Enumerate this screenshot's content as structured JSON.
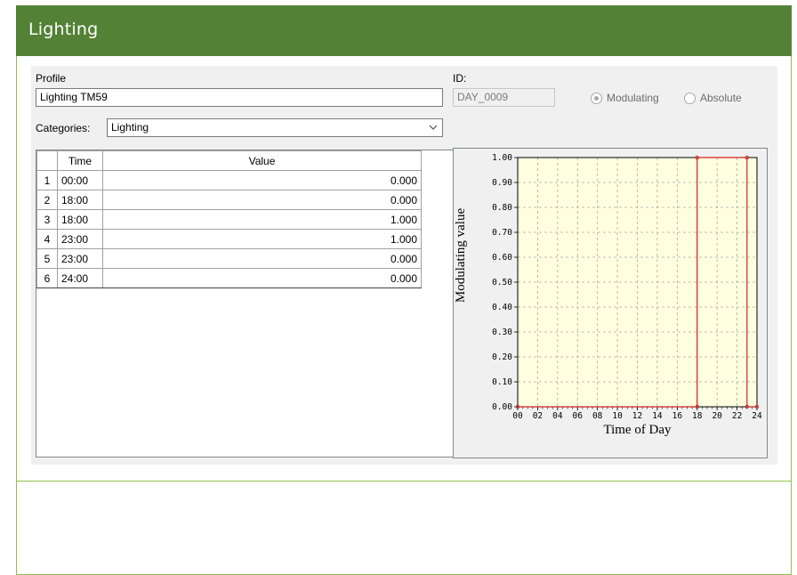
{
  "header": {
    "title": "Lighting"
  },
  "form": {
    "profile_label": "Profile",
    "profile_value": "Lighting TM59",
    "id_label": "ID:",
    "id_value": "DAY_0009",
    "radio_modulating": "Modulating",
    "radio_absolute": "Absolute",
    "categories_label": "Categories:",
    "categories_value": "Lighting"
  },
  "table": {
    "headers": [
      "Time",
      "Value"
    ],
    "rows": [
      {
        "n": "1",
        "time": "00:00",
        "value": "0.000"
      },
      {
        "n": "2",
        "time": "18:00",
        "value": "0.000"
      },
      {
        "n": "3",
        "time": "18:00",
        "value": "1.000"
      },
      {
        "n": "4",
        "time": "23:00",
        "value": "1.000"
      },
      {
        "n": "5",
        "time": "23:00",
        "value": "0.000"
      },
      {
        "n": "6",
        "time": "24:00",
        "value": "0.000"
      }
    ]
  },
  "chart_data": {
    "type": "line",
    "xlabel": "Time of Day",
    "ylabel": "Modulating value",
    "xlim": [
      0,
      24
    ],
    "ylim": [
      0,
      1
    ],
    "x_ticks": [
      "00",
      "02",
      "04",
      "06",
      "08",
      "10",
      "12",
      "14",
      "16",
      "18",
      "20",
      "22",
      "24"
    ],
    "y_ticks": [
      "0.00",
      "0.10",
      "0.20",
      "0.30",
      "0.40",
      "0.50",
      "0.60",
      "0.70",
      "0.80",
      "0.90",
      "1.00"
    ],
    "grid": true,
    "colors": {
      "line": "#d02020",
      "plot_bg": "#ffffe0",
      "grid": "#a8a8a8"
    },
    "series": [
      {
        "x": [
          0,
          18,
          18,
          23,
          23,
          24
        ],
        "y": [
          0,
          0,
          1,
          1,
          0,
          0
        ]
      }
    ]
  }
}
